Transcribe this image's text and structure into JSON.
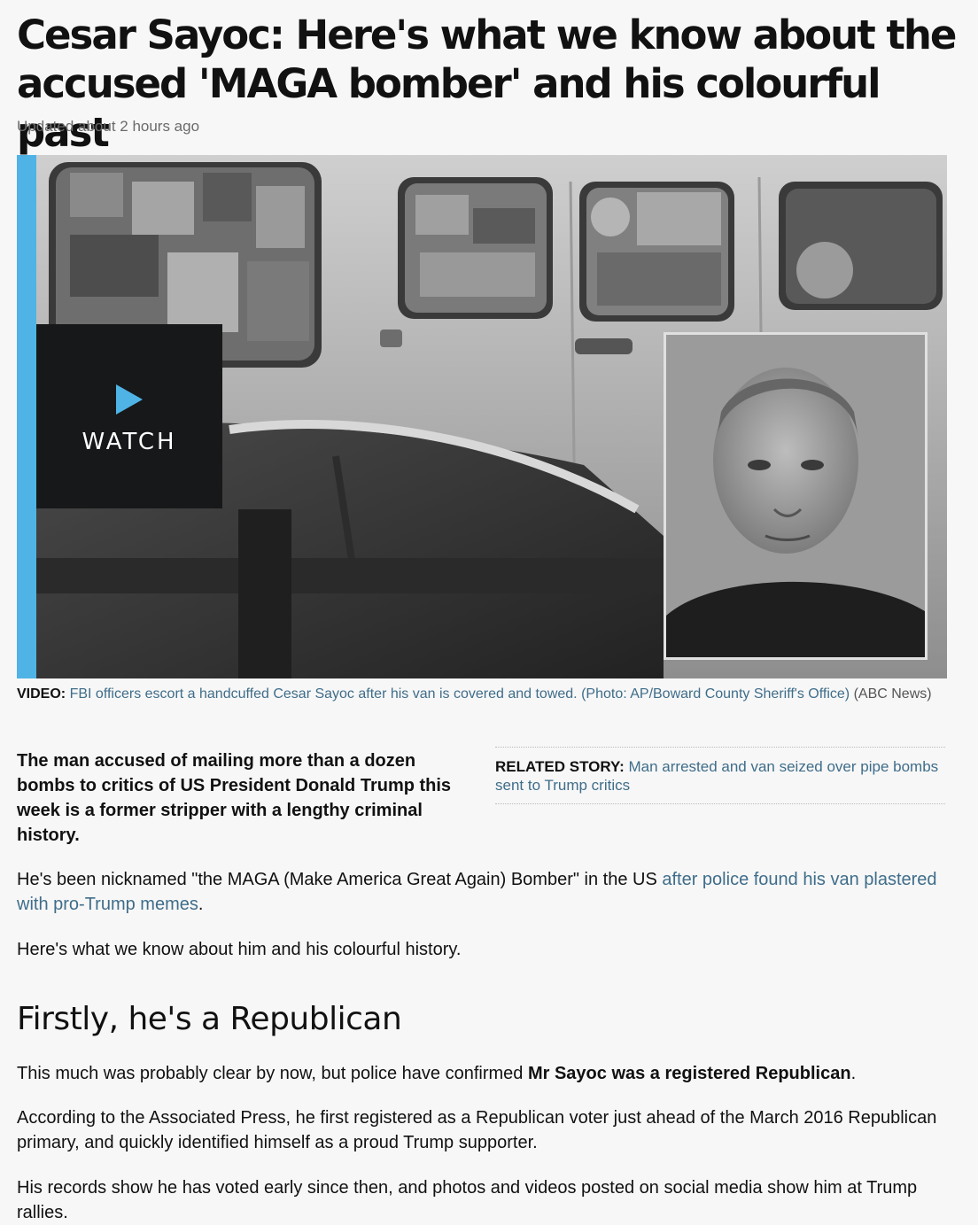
{
  "article": {
    "headline": "Cesar Sayoc: Here's what we know about the accused 'MAGA bomber' and his colourful past",
    "updated": "Updated about 2 hours ago",
    "watch_label": "WATCH",
    "caption": {
      "prefix": "VIDEO:",
      "text": "FBI officers escort a handcuffed Cesar Sayoc after his van is covered and towed. (Photo: AP/Boward County Sheriff's Office)",
      "source": "(ABC News)"
    },
    "lede": "The man accused of mailing more than a dozen bombs to critics of US President Donald Trump this week is a former stripper with a lengthy criminal history.",
    "related": {
      "label": "RELATED STORY:",
      "link": "Man arrested and van seized over pipe bombs sent to Trump critics"
    },
    "p1_text": "He's been nicknamed \"the MAGA (Make America Great Again) Bomber\" in the US",
    "p1_link": "after police found his van plastered with pro-Trump memes",
    "p1_end": ".",
    "p2": "Here's what we know about him and his colourful history.",
    "subhead": "Firstly, he's a Republican",
    "p3_text": "This much was probably clear by now, but police have confirmed",
    "p3_bold": "Mr Sayoc was a registered Republican",
    "p3_end": ".",
    "p4": "According to the Associated Press, he first registered as a Republican voter just ahead of the March 2016 Republican primary, and quickly identified himself as a proud Trump supporter.",
    "p5": "His records show he has voted early since then, and photos and videos posted on social media show him at Trump rallies."
  },
  "colors": {
    "accent": "#4fb3e6",
    "link": "#3f6d8a",
    "watch_bg": "#16181a"
  },
  "icons": [
    "play-icon"
  ]
}
